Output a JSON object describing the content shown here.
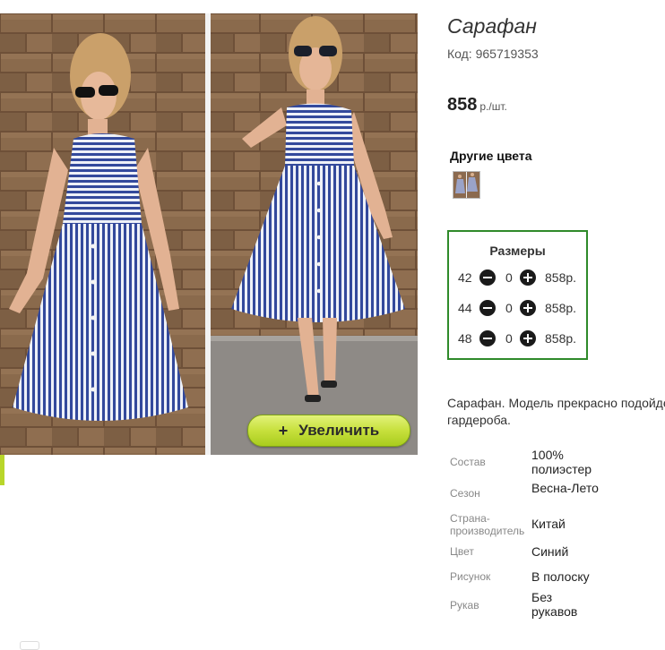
{
  "product": {
    "title": "Сарафан",
    "code": "Код: 965719353",
    "price": "858",
    "price_unit": "р./шт."
  },
  "gallery": {
    "zoom_label": "Увеличить",
    "zoom_icon": "+"
  },
  "colors": {
    "title": "Другие цвета",
    "thumbnail_icon": "dress-thumbnail"
  },
  "sizes": {
    "title": "Размеры",
    "rows": [
      {
        "size": "42",
        "qty": "0",
        "price": "858р."
      },
      {
        "size": "44",
        "qty": "0",
        "price": "858р."
      },
      {
        "size": "48",
        "qty": "0",
        "price": "858р."
      }
    ]
  },
  "description": {
    "line1": "Сарафан. Модель прекрасно подойдет",
    "line2": "гардероба."
  },
  "specs": [
    {
      "label": "Состав",
      "value": "100% полиэстер"
    },
    {
      "label": "Сезон",
      "value": "Весна-Лето"
    },
    {
      "label": "Страна-производитель",
      "value": "Китай"
    },
    {
      "label": "Цвет",
      "value": "Синий"
    },
    {
      "label": "Рисунок",
      "value": "В полоску"
    },
    {
      "label": "Рукав",
      "value": "Без рукавов"
    }
  ],
  "colors_palette": {
    "accent_green": "#2f8a2a",
    "zoom_button": "#c7e03c",
    "dress_blue": "#3b55a8"
  }
}
